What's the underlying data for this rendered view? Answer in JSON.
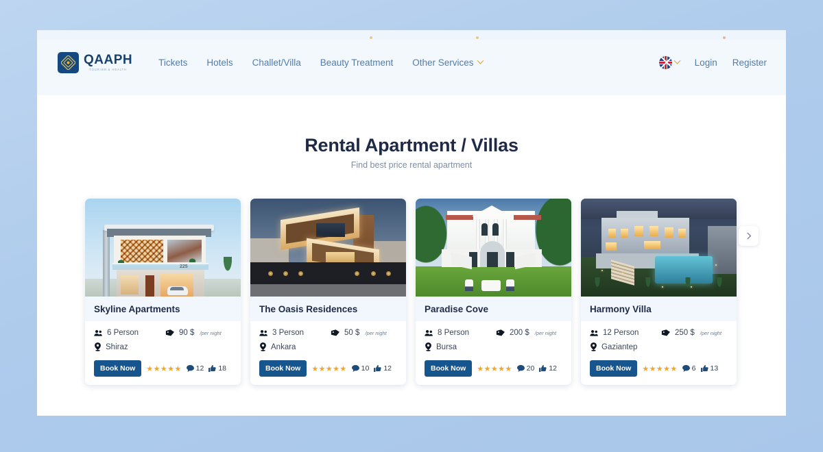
{
  "header": {
    "logo": {
      "name": "QAAPH",
      "tagline": "TOURISM & HEALTH"
    },
    "nav": [
      {
        "label": "Tickets"
      },
      {
        "label": "Hotels"
      },
      {
        "label": "Challet/Villa"
      },
      {
        "label": "Beauty Treatment"
      },
      {
        "label": "Other Services",
        "has_dropdown": true
      }
    ],
    "language": {
      "code": "EN",
      "flag": "uk-flag"
    },
    "login_label": "Login",
    "register_label": "Register"
  },
  "main": {
    "title": "Rental Apartment / Villas",
    "subtitle": "Find best price rental apartment",
    "carousel": {
      "prev_label": "‹",
      "next_label": "›"
    }
  },
  "labels": {
    "book_now": "Book Now",
    "per_night": "/per night",
    "currency": "$",
    "stars": "★★★★★"
  },
  "colors": {
    "accent_blue": "#17558f",
    "title_navy": "#1f2b46",
    "nav_blue": "#4f7dae",
    "star_gold": "#f5a623",
    "header_bg": "#f3f8fd",
    "card_title_bg": "#f1f7fd"
  },
  "cards": [
    {
      "title": "Skyline Apartments",
      "capacity": "6 Person",
      "price": "90 $",
      "location": "Shiraz",
      "comments": "12",
      "likes": "18",
      "image": "modern-villa-daylight"
    },
    {
      "title": "The Oasis Residences",
      "capacity": "3 Person",
      "price": "50 $",
      "location": "Ankara",
      "comments": "10",
      "likes": "12",
      "image": "angular-villa-dusk"
    },
    {
      "title": "Paradise Cove",
      "capacity": "8 Person",
      "price": "200 $",
      "location": "Bursa",
      "comments": "20",
      "likes": "12",
      "image": "white-mansion-lawn"
    },
    {
      "title": "Harmony Villa",
      "capacity": "12 Person",
      "price": "250 $",
      "location": "Gaziantep",
      "comments": "6",
      "likes": "13",
      "image": "night-aerial-pool-villa"
    }
  ]
}
